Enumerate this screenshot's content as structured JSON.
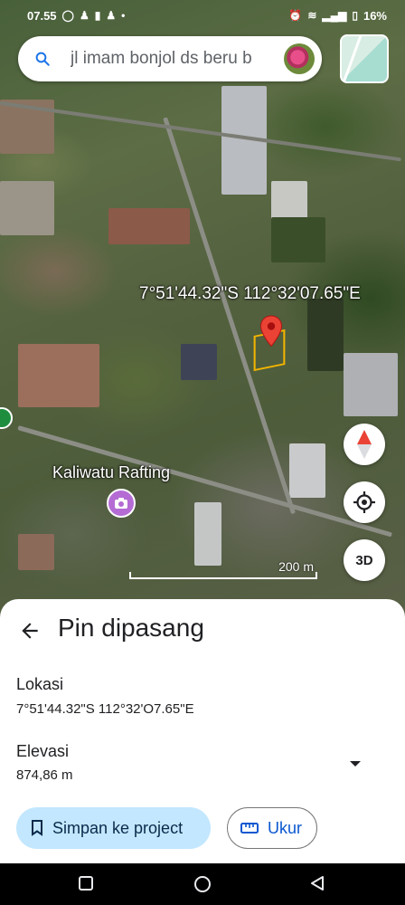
{
  "status_bar": {
    "time": "07.55",
    "battery": "16%"
  },
  "search": {
    "query": "jl imam bonjol ds beru b"
  },
  "map": {
    "coordinate_label": "7°51'44.32\"S 112°32'07.65\"E",
    "poi_label": "Kaliwatu Rafting",
    "scale_label": "200 m",
    "threed_label": "3D"
  },
  "sheet": {
    "title": "Pin dipasang",
    "location_label": "Lokasi",
    "location_value": "7°51'44.32\"S 112°32'O7.65\"E",
    "elevation_label": "Elevasi",
    "elevation_value": "874,86 m",
    "save_label": "Simpan ke project",
    "measure_label": "Ukur"
  },
  "colors": {
    "accent": "#0b57d0",
    "save_bg": "#c2e7ff",
    "pin": "#ea4335",
    "parcel": "#f2b400"
  }
}
